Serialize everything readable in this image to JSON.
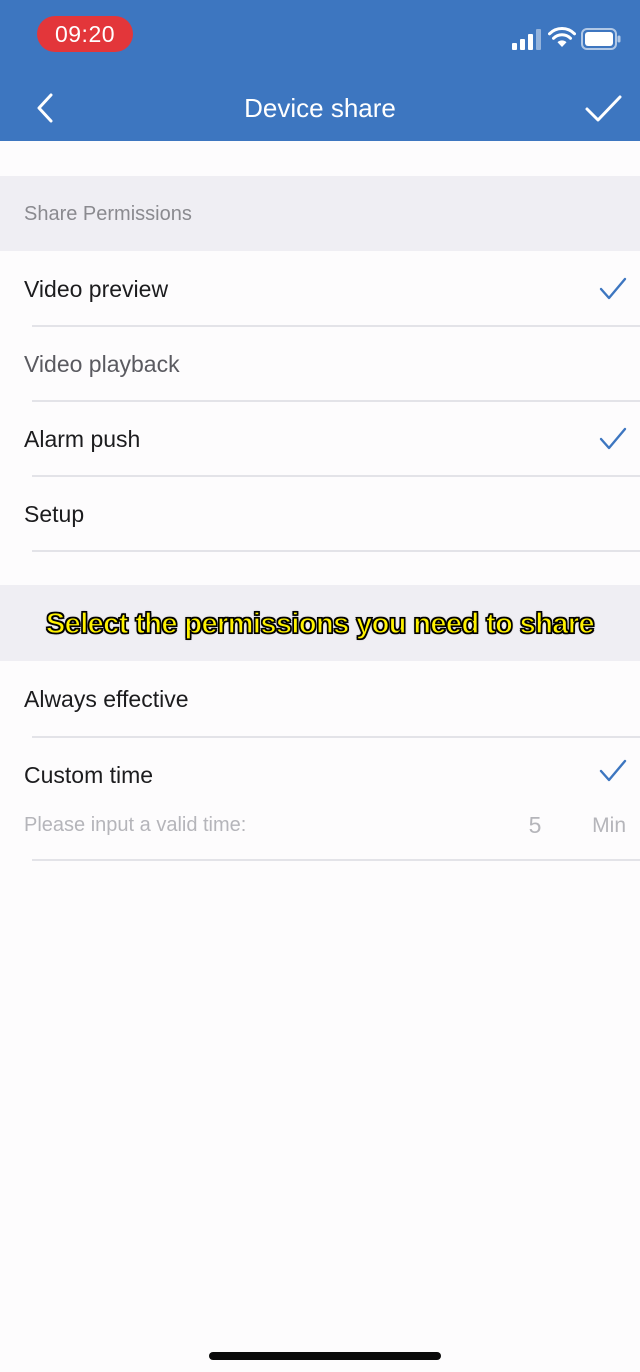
{
  "status_bar": {
    "time": "09:20"
  },
  "nav": {
    "title": "Device share",
    "back_icon": "chevron-left-icon",
    "confirm_icon": "checkmark-icon"
  },
  "permissions": {
    "section_label": "Share Permissions",
    "items": [
      {
        "label": "Video preview",
        "checked": true
      },
      {
        "label": "Video playback",
        "checked": false
      },
      {
        "label": "Alarm push",
        "checked": true
      },
      {
        "label": "Setup",
        "checked": false
      }
    ]
  },
  "validity": {
    "options": [
      {
        "label": "Always effective",
        "checked": false
      },
      {
        "label": "Custom time",
        "checked": true
      }
    ],
    "input_prompt": "Please input a valid time:",
    "input_value": "5",
    "input_unit": "Min"
  },
  "caption": "Select the permissions you need to share",
  "colors": {
    "header_blue": "#3d76c0",
    "check_blue": "#3d76c0",
    "time_pill_red": "#e3363a",
    "caption_yellow": "#fff200"
  }
}
